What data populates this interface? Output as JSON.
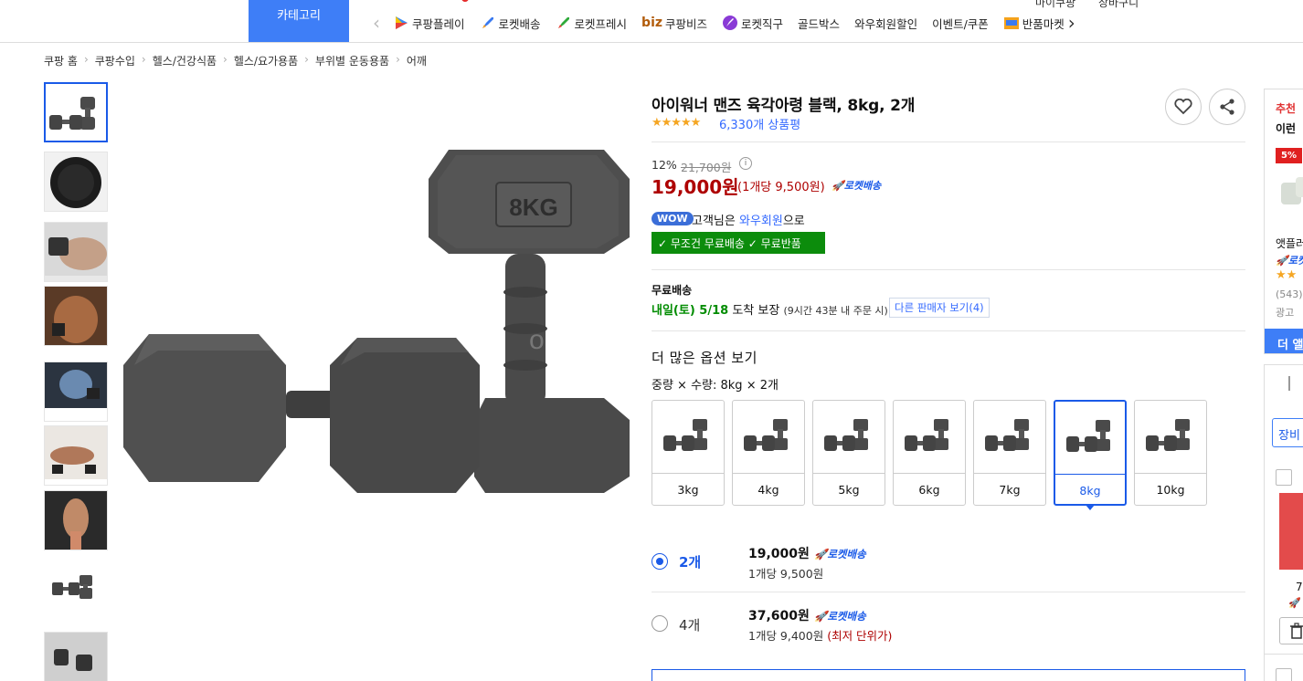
{
  "header": {
    "category_label": "카테고리",
    "mypage_label": "마이쿠팡",
    "cart_label": "장바구니",
    "nav_items": [
      {
        "label": "쿠팡플레이",
        "icon": "play-icon"
      },
      {
        "label": "로켓배송",
        "icon": "rocket-icon"
      },
      {
        "label": "로켓프레시",
        "icon": "rocket-fresh-icon"
      },
      {
        "label": "쿠팡비즈",
        "prefix": "biz",
        "icon": "biz-logo"
      },
      {
        "label": "로켓직구",
        "icon": "globe-rocket-icon"
      },
      {
        "label": "골드박스",
        "icon": ""
      },
      {
        "label": "와우회원할인",
        "icon": ""
      },
      {
        "label": "이벤트/쿠폰",
        "icon": ""
      },
      {
        "label": "반품마켓",
        "icon": "return-market-icon"
      }
    ]
  },
  "breadcrumb": [
    "쿠팡 홈",
    "쿠팡수입",
    "헬스/건강식품",
    "헬스/요가용품",
    "부위별 운동용품",
    "어깨"
  ],
  "main_image": {
    "weight_label": "8KG",
    "watermark": "o"
  },
  "product": {
    "title": "아이워너 맨즈 육각아령 블랙, 8kg, 2개",
    "stars": "★★★★★",
    "rating": 4.5,
    "review_count": "6,330개 상품평",
    "discount": "12%",
    "original_price": "21,700원",
    "info_icon": "ⓘ",
    "price": "19,000원",
    "unit_price": "(1개당 9,500원)",
    "rocket_label": "로켓배송",
    "wow_badge": "WOW",
    "wow_text_pre": "고객님은 ",
    "wow_text_link": "와우회원",
    "wow_text_post": "으로",
    "free_badge": "✓ 무조건 무료배송 ✓ 무료반품",
    "shipping_label": "무료배송",
    "arrival_date": "내일(토) 5/18",
    "arrival_mid": " 도착 보장 ",
    "arrival_small": "(9시간 43분 내 주문 시)",
    "other_sellers": "다른 판매자 보기(4)",
    "more_options": "더 많은 옵션 보기",
    "option_label": "중량 × 수량: 8kg × 2개",
    "weights": [
      "3kg",
      "4kg",
      "5kg",
      "6kg",
      "7kg",
      "8kg",
      "10kg"
    ],
    "selected_weight": "8kg",
    "quantities": [
      {
        "qty": "2개",
        "price": "19,000원",
        "rocket": "로켓배송",
        "unit": "1개당 9,500원",
        "note": "",
        "selected": true
      },
      {
        "qty": "4개",
        "price": "37,600원",
        "rocket": "로켓배송",
        "unit": "1개당 9,400원",
        "note": "(최저 단위가)",
        "selected": false
      }
    ]
  },
  "sidebar": {
    "rec_title": "추천",
    "rec_sub": "이런",
    "discount_badge": "5%",
    "item_name": "앳플러",
    "item_rocket": "로켓",
    "item_reviews": "(543)",
    "ad_label": "광고",
    "more_btn": "더 앨",
    "cart_btn": "장비",
    "price_partial": "7,"
  },
  "colors": {
    "brand_blue": "#346aff",
    "price_red": "#ae0000",
    "wow_green": "#0c8c0c",
    "category_blue": "#3e7ef7"
  }
}
